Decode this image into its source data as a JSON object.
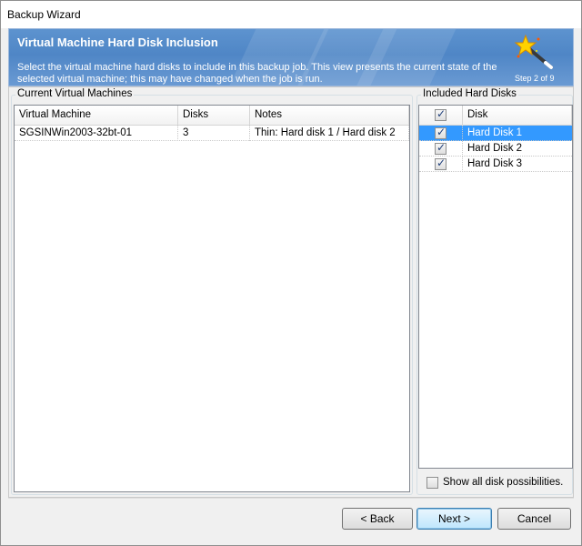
{
  "window": {
    "title": "Backup Wizard"
  },
  "header": {
    "title": "Virtual Machine Hard Disk Inclusion",
    "description": "Select the virtual machine hard disks to include in this backup job.  This view presents the current state of the selected virtual machine; this may have changed when the job is run.",
    "step": "Step 2 of 9",
    "icon": "magic-wand-icon"
  },
  "vm_group": {
    "legend": "Current Virtual Machines",
    "columns": [
      "Virtual Machine",
      "Disks",
      "Notes"
    ],
    "rows": [
      {
        "name": "SGSINWin2003-32bt-01",
        "disks": "3",
        "notes": "Thin: Hard disk 1 / Hard disk 2"
      }
    ]
  },
  "disk_group": {
    "legend": "Included Hard Disks",
    "header_label": "Disk",
    "header_checked": true,
    "disks": [
      {
        "label": "Hard Disk 1",
        "checked": true,
        "selected": true
      },
      {
        "label": "Hard Disk 2",
        "checked": true,
        "selected": false
      },
      {
        "label": "Hard Disk 3",
        "checked": true,
        "selected": false
      }
    ],
    "show_all_label": "Show all disk possibilities.",
    "show_all_checked": false
  },
  "buttons": {
    "back": "< Back",
    "next": "Next >",
    "cancel": "Cancel"
  },
  "colors": {
    "header_blue": "#5d93cf",
    "selection": "#3399ff"
  }
}
